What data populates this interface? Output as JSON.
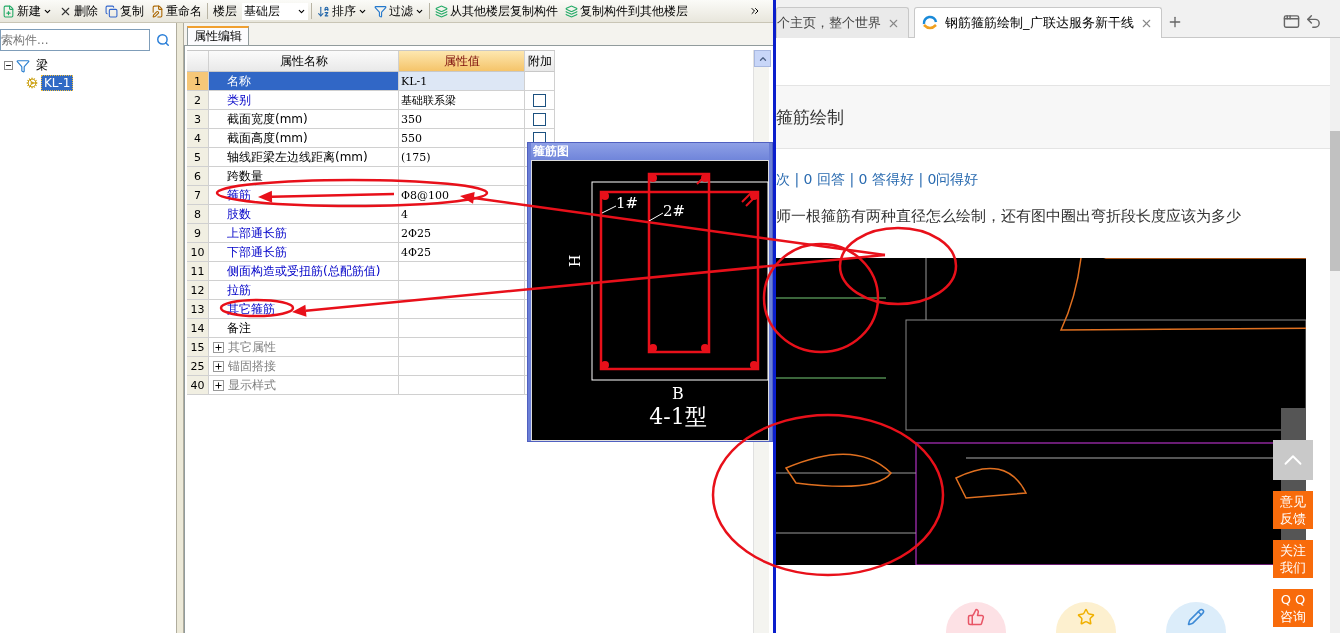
{
  "toolbar": {
    "items": [
      {
        "kind": "button",
        "label": "新建",
        "dropdown": true
      },
      {
        "kind": "button",
        "label": "删除",
        "dropdown": false
      },
      {
        "kind": "button",
        "label": "复制",
        "dropdown": false
      },
      {
        "kind": "button",
        "label": "重命名",
        "dropdown": false
      },
      {
        "kind": "label",
        "label": "楼层"
      },
      {
        "kind": "select",
        "value": "基础层"
      },
      {
        "kind": "button",
        "label": "排序",
        "dropdown": true
      },
      {
        "kind": "button",
        "label": "过滤",
        "dropdown": true
      },
      {
        "kind": "button",
        "label": "从其他楼层复制构件",
        "dropdown": false
      },
      {
        "kind": "button",
        "label": "复制构件到其他楼层",
        "dropdown": false
      }
    ]
  },
  "component_tree": {
    "search": {
      "placeholder": "索构件..."
    },
    "items": [
      {
        "label": "梁",
        "expanded": true,
        "selected": false,
        "children": [
          {
            "label": "KL-1",
            "selected": true
          }
        ]
      }
    ]
  },
  "property_panel": {
    "tabs": [
      {
        "label": "属性编辑",
        "selected": true
      }
    ],
    "table": {
      "columns": [
        "属性名称",
        "属性值",
        "附加"
      ],
      "rows": [
        {
          "num": "1",
          "name": "名称",
          "value": "KL-1",
          "kind": "plain",
          "selected": true
        },
        {
          "num": "2",
          "name": "类别",
          "value": "基础联系梁",
          "kind": "link",
          "selected": false,
          "attach": {
            "checked": false
          }
        },
        {
          "num": "3",
          "name": "截面宽度(mm)",
          "value": "350",
          "kind": "plain",
          "selected": false,
          "attach": {
            "checked": false
          }
        },
        {
          "num": "4",
          "name": "截面高度(mm)",
          "value": "550",
          "kind": "plain",
          "selected": false,
          "attach": {
            "checked": false
          }
        },
        {
          "num": "5",
          "name": "轴线距梁左边线距离(mm)",
          "value": "(175)",
          "kind": "plain",
          "selected": false
        },
        {
          "num": "6",
          "name": "跨数量",
          "kind": "plain",
          "selected": false
        },
        {
          "num": "7",
          "name": "箍筋",
          "value": "Φ8@100",
          "kind": "link",
          "selected": false
        },
        {
          "num": "8",
          "name": "肢数",
          "value": "4",
          "kind": "link",
          "selected": false
        },
        {
          "num": "9",
          "name": "上部通长筋",
          "value": "2Φ25",
          "kind": "link",
          "selected": false
        },
        {
          "num": "10",
          "name": "下部通长筋",
          "value": "4Φ25",
          "kind": "link",
          "selected": false
        },
        {
          "num": "11",
          "name": "侧面构造或受扭筋(总配筋值)",
          "kind": "link",
          "selected": false
        },
        {
          "num": "12",
          "name": "拉筋",
          "kind": "link",
          "selected": false
        },
        {
          "num": "13",
          "name": "其它箍筋",
          "kind": "link",
          "selected": false
        },
        {
          "num": "14",
          "name": "备注",
          "kind": "plain",
          "selected": false
        },
        {
          "num": "15",
          "name": "其它属性",
          "kind": "group",
          "expanded": false,
          "selected": false
        },
        {
          "num": "25",
          "name": "锚固搭接",
          "kind": "group",
          "expanded": false,
          "selected": false
        },
        {
          "num": "40",
          "name": "显示样式",
          "kind": "group",
          "expanded": false,
          "selected": false
        }
      ]
    }
  },
  "stirrup_dialog": {
    "title": "箍筋图",
    "labels": {
      "stirrup_1": "1#",
      "stirrup_2": "2#",
      "height": "H",
      "width": "B",
      "type": "4-1型"
    }
  },
  "browser": {
    "tabs": [
      {
        "title": "个主页，整个世界",
        "selected": false
      },
      {
        "title": "钢筋箍筋绘制_广联达服务新干线",
        "selected": true
      }
    ],
    "page": {
      "title": "箍筋绘制",
      "stats": "次 | 0 回答 | 0 答得好 | 0问得好",
      "question": "师一根箍筋有两种直径怎么绘制，还有图中圈出弯折段长度应该为多少",
      "side_buttons": [
        {
          "lines": [
            "意见",
            "反馈"
          ]
        },
        {
          "lines": [
            "关注",
            "我们"
          ]
        },
        {
          "lines": [
            "Q Q",
            "咨询"
          ]
        }
      ]
    }
  }
}
